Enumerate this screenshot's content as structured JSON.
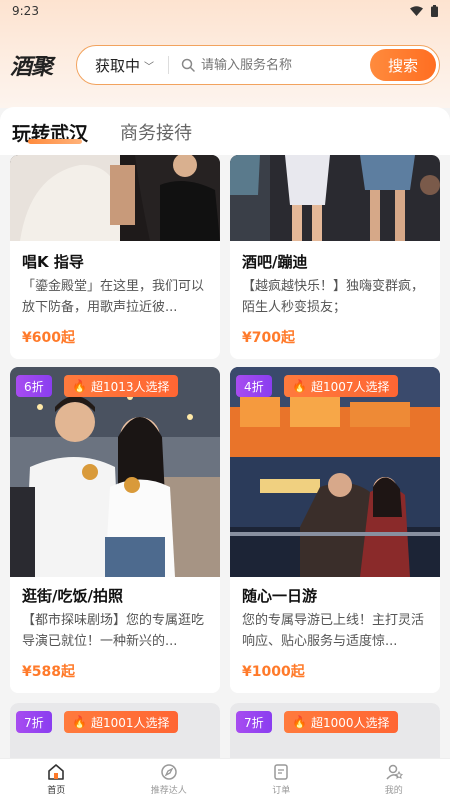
{
  "status_bar": {
    "time": "9:23"
  },
  "header": {
    "logo": "酒聚",
    "location": "获取中",
    "search_placeholder": "请输入服务名称",
    "search_button": "搜索"
  },
  "tabs": [
    {
      "label": "玩转武汉",
      "active": true
    },
    {
      "label": "商务接待",
      "active": false
    }
  ],
  "cards": [
    {
      "title": "唱K 指导",
      "desc": "「鎏金殿堂」在这里，我们可以放下防备，用歌声拉近彼...",
      "price": "¥600起"
    },
    {
      "title": "酒吧/蹦迪",
      "desc": "【越疯越快乐！】独嗨变群疯，陌生人秒变损友；",
      "price": "¥700起"
    },
    {
      "title": "逛街/吃饭/拍照",
      "desc": "【都市探味剧场】您的专属逛吃导演已就位！一种新兴的...",
      "price": "¥588起",
      "discount": "6折",
      "hot": "超1013人选择"
    },
    {
      "title": "随心一日游",
      "desc": "您的专属导游已上线！主打灵活响应、贴心服务与适度惊...",
      "price": "¥1000起",
      "discount": "4折",
      "hot": "超1007人选择"
    },
    {
      "discount": "7折",
      "hot": "超1001人选择"
    },
    {
      "discount": "7折",
      "hot": "超1000人选择"
    }
  ],
  "tabbar": [
    {
      "label": "首页",
      "icon": "home-icon",
      "active": true
    },
    {
      "label": "推荐达人",
      "icon": "compass-icon",
      "active": false
    },
    {
      "label": "订单",
      "icon": "order-icon",
      "active": false
    },
    {
      "label": "我的",
      "icon": "user-icon",
      "active": false
    }
  ],
  "colors": {
    "accent": "#ff7a2a",
    "discount": "#9b45f0",
    "hot": "#ff6e2e"
  }
}
